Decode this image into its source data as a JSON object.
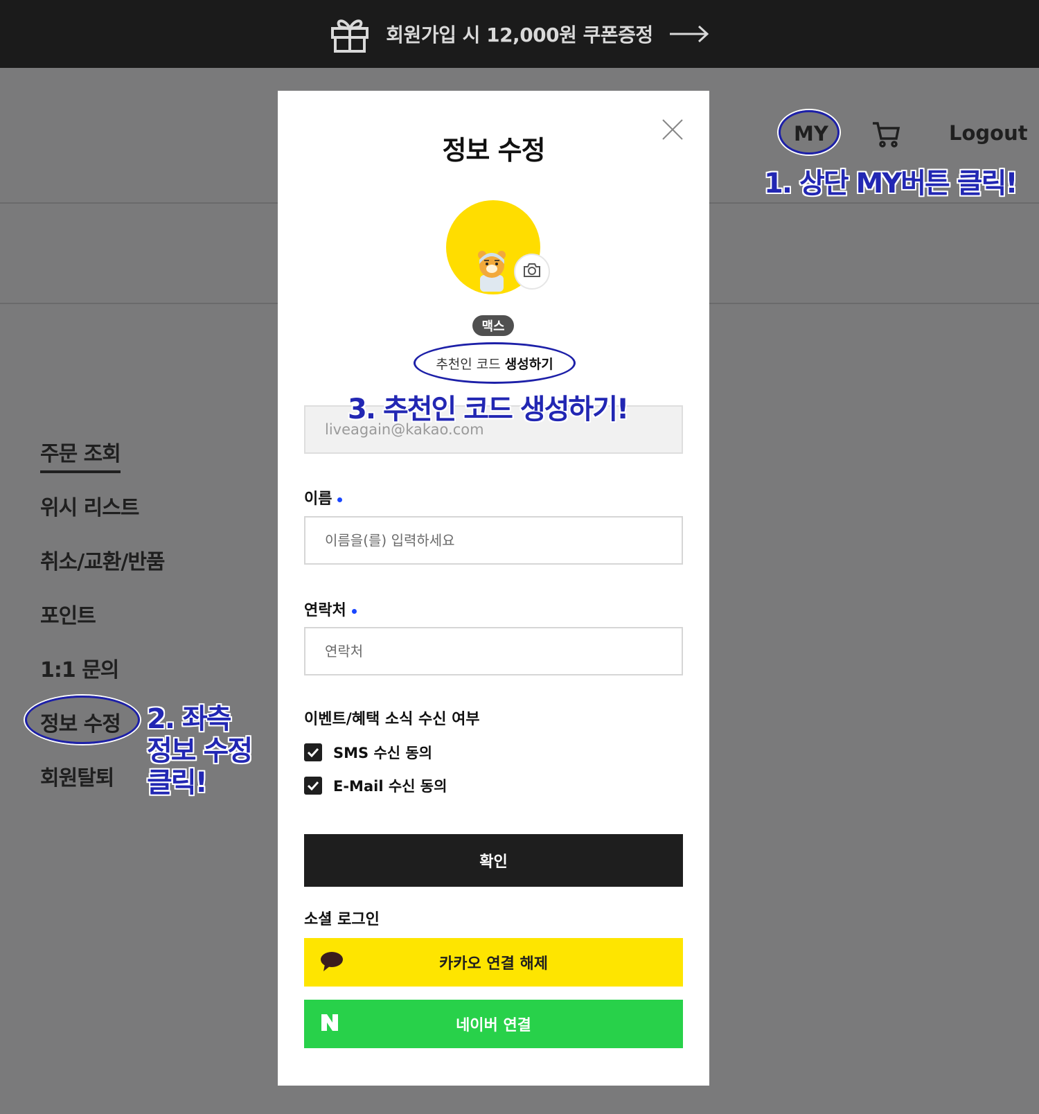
{
  "promo": {
    "text": "회원가입 시 12,000원 쿠폰증정"
  },
  "header": {
    "my_label": "MY",
    "logout_label": "Logout"
  },
  "annotations": {
    "step1": "1. 상단 MY버튼 클릭!",
    "step2_line1": "2. 좌측",
    "step2_line2": "정보 수정",
    "step2_line3": "클릭!",
    "step3": "3. 추천인 코드 생성하기!"
  },
  "sidebar": {
    "items": [
      {
        "label": "주문 조회"
      },
      {
        "label": "위시 리스트"
      },
      {
        "label": "취소/교환/반품"
      },
      {
        "label": "포인트"
      },
      {
        "label": "1:1 문의"
      },
      {
        "label": "정보 수정"
      },
      {
        "label": "회원탈퇴"
      }
    ]
  },
  "modal": {
    "title": "정보 수정",
    "nickname": "맥스",
    "referral_prefix": "추천인 코드",
    "referral_action": "생성하기",
    "email": "liveagain@kakao.com",
    "name_label": "이름",
    "name_placeholder": "이름을(를) 입력하세요",
    "phone_label": "연락처",
    "phone_placeholder": "연락처",
    "marketing_label": "이벤트/혜택 소식 수신 여부",
    "sms_label": "SMS 수신 동의",
    "email_consent_label": "E-Mail 수신 동의",
    "confirm_label": "확인",
    "social_label": "소셜 로그인",
    "kakao_label": "카카오 연결 해제",
    "naver_label": "네이버 연결"
  },
  "colors": {
    "promo_bg": "#1b1b1b",
    "overlay": "#7a7a7b",
    "annotation": "#2227b3",
    "kakao": "#fee500",
    "naver": "#28d14a",
    "required_dot": "#1a47ff"
  },
  "icons": [
    "gift-icon",
    "arrow-right-icon",
    "cart-icon",
    "close-icon",
    "camera-icon",
    "check-icon",
    "kakao-chat-icon",
    "naver-n-icon"
  ]
}
